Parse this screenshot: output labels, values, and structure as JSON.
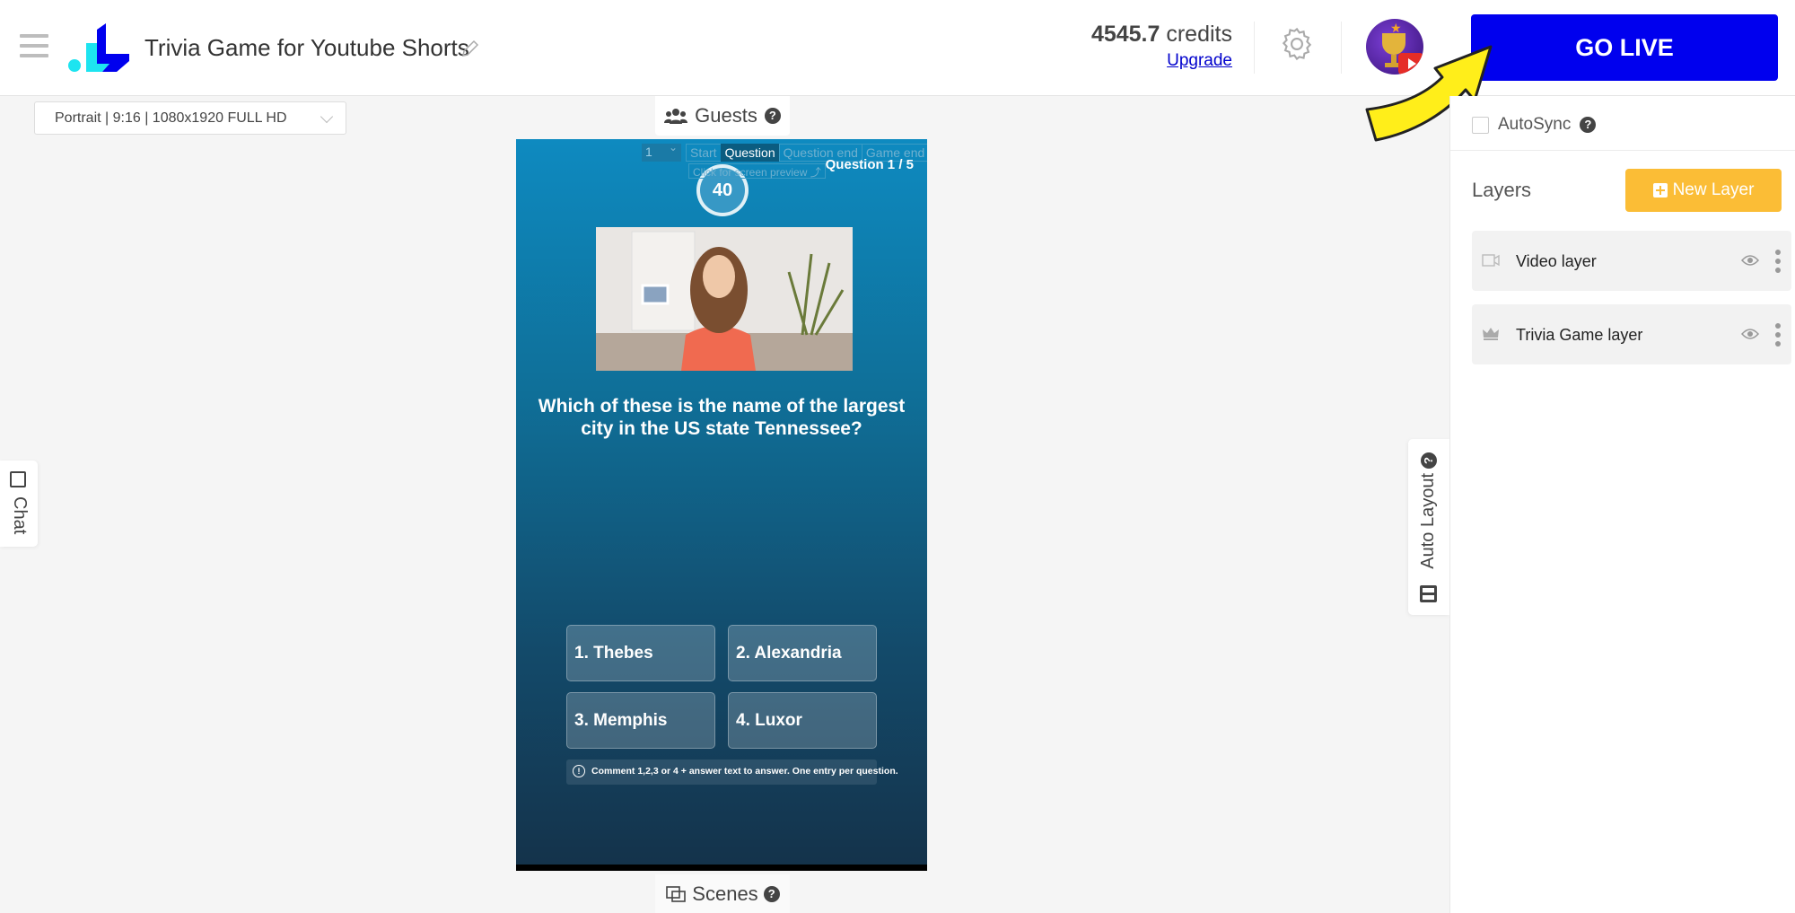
{
  "header": {
    "app_title": "Trivia Game for Youtube Shorts",
    "credits_amount": "4545.7",
    "credits_label": "credits",
    "upgrade_label": "Upgrade",
    "go_live_label": "GO LIVE"
  },
  "canvas": {
    "format_select": "Portrait | 9:16 | 1080x1920 FULL HD",
    "guests_label": "Guests",
    "scenes_label": "Scenes",
    "chat_label": "Chat",
    "auto_layout_label": "Auto Layout",
    "help_glyph": "?"
  },
  "stage": {
    "scene_number": "1",
    "tabs": [
      {
        "label": "Start",
        "active": false
      },
      {
        "label": "Question",
        "active": true
      },
      {
        "label": "Question end",
        "active": false
      },
      {
        "label": "Game end",
        "active": false
      }
    ],
    "preview_link": "Click for screen preview ⤴",
    "question_counter": "Question 1 / 5",
    "timer": "40",
    "question": "Which of these is the name of the largest city in the US state Tennessee?",
    "answers": [
      "1. Thebes",
      "2. Alexandria",
      "3. Memphis",
      "4. Luxor"
    ],
    "hint": "Comment 1,2,3 or 4 + answer text to answer. One entry per question.",
    "info_glyph": "!"
  },
  "right_panel": {
    "autosync_label": "AutoSync",
    "autosync_checked": false,
    "layers_title": "Layers",
    "new_layer_label": "New Layer",
    "layers": [
      {
        "name": "Video layer",
        "icon": "video-camera-icon",
        "visible": true
      },
      {
        "name": "Trivia Game layer",
        "icon": "crown-icon",
        "visible": true
      }
    ]
  },
  "colors": {
    "go_live": "#0000ee",
    "new_layer": "#fbbd36",
    "stage_top": "#0e8ac0",
    "stage_bottom": "#14324a",
    "logo_blue": "#0000ee",
    "logo_cyan": "#1de4f0"
  }
}
